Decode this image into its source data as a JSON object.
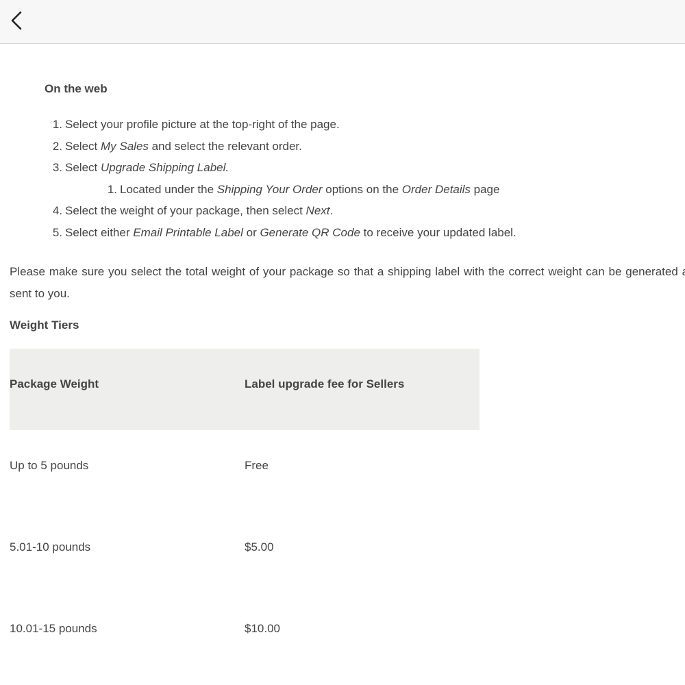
{
  "header": {
    "back_icon": "chevron-left-icon"
  },
  "section": {
    "heading": "On the web",
    "steps": [
      {
        "num": "1.",
        "parts": [
          {
            "t": "Select your profile picture at the top-right of the page.",
            "i": false
          }
        ]
      },
      {
        "num": "2.",
        "parts": [
          {
            "t": "Select ",
            "i": false
          },
          {
            "t": "My Sales",
            "i": true
          },
          {
            "t": " and select the relevant order.",
            "i": false
          }
        ]
      },
      {
        "num": "3.",
        "parts": [
          {
            "t": "Select ",
            "i": false
          },
          {
            "t": "Upgrade Shipping Label.",
            "i": true
          }
        ]
      },
      {
        "num": "1.",
        "sub": true,
        "parts": [
          {
            "t": "Located under the ",
            "i": false
          },
          {
            "t": "Shipping Your Order",
            "i": true
          },
          {
            "t": " options on the ",
            "i": false
          },
          {
            "t": "Order Details",
            "i": true
          },
          {
            "t": " page",
            "i": false
          }
        ]
      },
      {
        "num": "4.",
        "parts": [
          {
            "t": "Select the weight of your package, then select ",
            "i": false
          },
          {
            "t": "Next",
            "i": true
          },
          {
            "t": ".",
            "i": false
          }
        ]
      },
      {
        "num": "5.",
        "parts": [
          {
            "t": "Select either ",
            "i": false
          },
          {
            "t": "Email Printable Label",
            "i": true
          },
          {
            "t": " or ",
            "i": false
          },
          {
            "t": "Generate QR Code",
            "i": true
          },
          {
            "t": " to receive your updated label.",
            "i": false
          }
        ]
      }
    ]
  },
  "note": "Please make sure you select the total weight of your package so that a shipping label with the correct weight can be generated and sent to you.",
  "tiers": {
    "heading": "Weight Tiers",
    "columns": [
      "Package Weight",
      "Label upgrade fee for Sellers"
    ],
    "rows": [
      [
        "Up to 5 pounds",
        "Free"
      ],
      [
        "5.01-10 pounds",
        "$5.00"
      ],
      [
        "10.01-15 pounds",
        "$10.00"
      ]
    ]
  }
}
